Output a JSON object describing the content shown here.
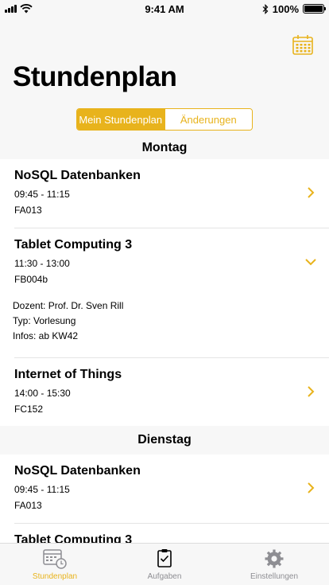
{
  "status_bar": {
    "time": "9:41 AM",
    "battery": "100%",
    "battery_level": 1.0
  },
  "header": {
    "title": "Stundenplan"
  },
  "segments": [
    {
      "label": "Mein Stundenplan",
      "selected": true
    },
    {
      "label": "Änderungen",
      "selected": false
    }
  ],
  "days": [
    {
      "name": "Montag",
      "lessons": [
        {
          "title": "NoSQL Datenbanken",
          "time": "09:45 - 11:15",
          "room": "FA013"
        },
        {
          "title": "Tablet Computing 3",
          "time": "11:30 - 13:00",
          "room": "FB004b",
          "details": {
            "dozent": "Dozent: Prof. Dr. Sven Rill",
            "typ": "Typ: Vorlesung",
            "infos": "Infos: ab KW42"
          }
        },
        {
          "title": "Internet of Things",
          "time": "14:00 - 15:30",
          "room": "FC152"
        }
      ]
    },
    {
      "name": "Dienstag",
      "lessons": [
        {
          "title": "NoSQL Datenbanken",
          "time": "09:45 - 11:15",
          "room": "FA013"
        },
        {
          "title": "Tablet Computing 3"
        }
      ]
    }
  ],
  "tabs": [
    {
      "label": "Stundenplan",
      "icon": "calendar-clock-icon",
      "active": true
    },
    {
      "label": "Aufgaben",
      "icon": "clipboard-check-icon",
      "active": false
    },
    {
      "label": "Einstellungen",
      "icon": "gear-icon",
      "active": false
    }
  ],
  "colors": {
    "accent": "#e8b31c",
    "inactive": "#8e8e93",
    "background": "#f7f7f7"
  }
}
